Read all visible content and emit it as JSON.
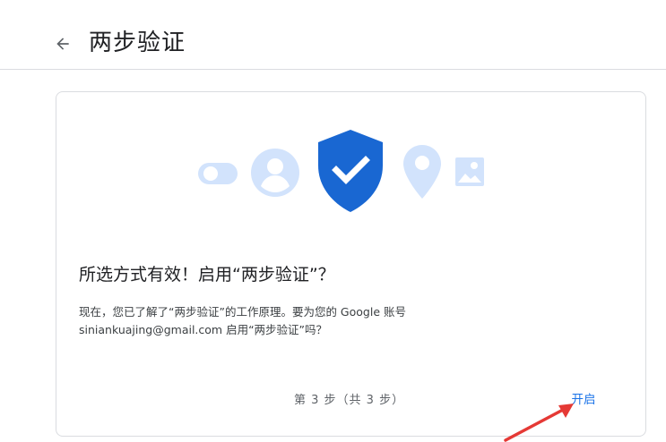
{
  "header": {
    "back_icon": "arrow-left-icon",
    "title": "两步验证"
  },
  "card": {
    "hero_icons": [
      "toggle-icon",
      "person-icon",
      "shield-check-icon",
      "location-pin-icon",
      "image-icon"
    ],
    "heading": "所选方式有效！启用“两步验证”？",
    "description_line1": "现在，您已了解了“两步验证”的工作原理。要为您的 Google 账号",
    "description_line2": "siniankuajing@gmail.com 启用“两步验证”吗？",
    "step_indicator": "第 3 步（共 3 步）",
    "enable_label": "开启"
  },
  "annotation": {
    "arrow_color": "#e53935"
  },
  "colors": {
    "accent": "#1a73e8",
    "shield": "#1967d2",
    "light_icon": "#d2e3fc"
  }
}
